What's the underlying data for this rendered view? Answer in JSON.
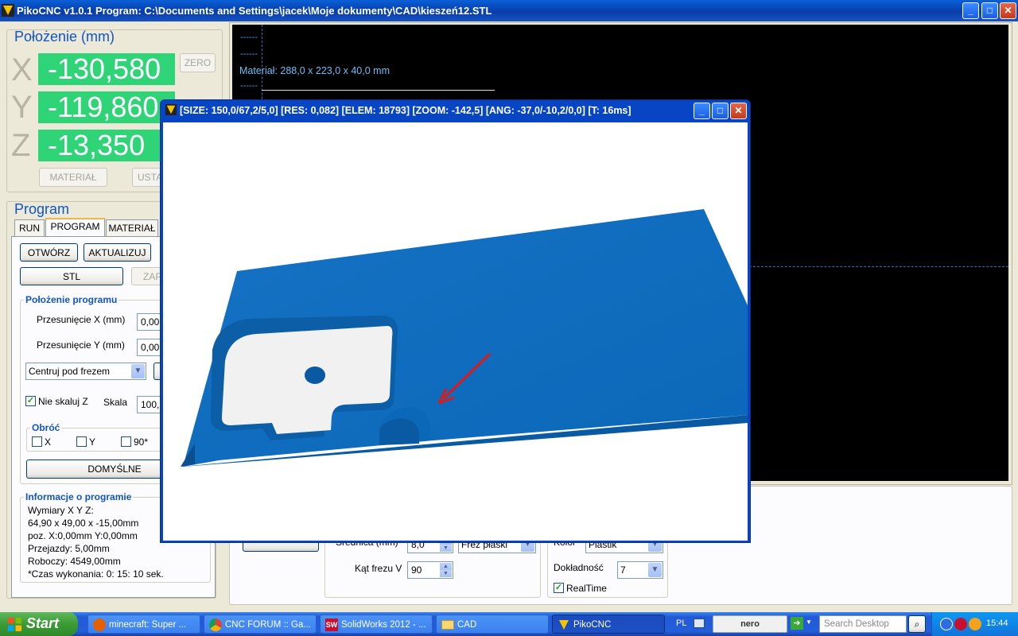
{
  "app": {
    "title": "PikoCNC v1.0.1    Program: C:\\Documents and Settings\\jacek\\Moje dokumenty\\CAD\\kieszeń12.STL"
  },
  "position": {
    "heading": "Położenie (mm)",
    "x_label": "X",
    "x_value": "-130,580",
    "y_label": "Y",
    "y_value": "-119,860",
    "z_label": "Z",
    "z_value": "-13,350",
    "zero_label": "ZERO",
    "material_label": "MATERIAŁ",
    "set_label": "USTA"
  },
  "program": {
    "heading": "Program",
    "tabs": [
      "RUN",
      "PROGRAM",
      "MATERIAŁ"
    ],
    "open_label": "OTWÓRZ",
    "update_label": "AKTUALIZUJ",
    "stl_label": "STL",
    "save_label": "ZAP",
    "placement": {
      "label": "Położenie programu",
      "offset_x_label": "Przesunięcie X (mm)",
      "offset_x_value": "0,00",
      "offset_y_label": "Przesunięcie Y (mm)",
      "offset_y_value": "0,00",
      "center_value": "Centruj pod frezem",
      "no_scale_z_label": "Nie skaluj Z",
      "scale_label": "Skala",
      "scale_value": "100,",
      "rotate_label": "Obróć",
      "rot_x": "X",
      "rot_y": "Y",
      "rot_90": "90*",
      "defaults_label": "DOMYŚLNE"
    },
    "info": {
      "label": "Informacje o programie",
      "lines": [
        "Wymiary X Y Z:",
        "64,90 x 49,00 x -15,00mm",
        "poz. X:0,00mm Y:0,00mm",
        "Przejazdy: 5,00mm",
        "Roboczy: 4549,00mm",
        "*Czas wykonania: 0: 15: 10 sek."
      ]
    }
  },
  "viewport": {
    "dash1": "------",
    "dash2": "------",
    "dash3": "------",
    "material_text": "Materiał: 288,0 x 223,0 x 40,0 mm"
  },
  "tool": {
    "diameter_label": "Średnica (mm)",
    "diameter_value": "8,0",
    "type_value": "Frez płaski",
    "angle_label": "Kąt frezu V",
    "angle_value": "90",
    "color_label": "Kolor",
    "color_value": "Plastik",
    "precision_label": "Dokładność",
    "precision_value": "7",
    "realtime_label": "RealTime"
  },
  "preview": {
    "title": "[SIZE: 150,0/67,2/5,0] [RES: 0,082] [ELEM: 18793] [ZOOM: -142,5] [ANG: -37,0/-10,2/0,0] [T: 16ms]"
  },
  "taskbar": {
    "start": "Start",
    "items": [
      "minecraft: Super ...",
      "CNC FORUM :: Ga...",
      "SolidWorks 2012 - ...",
      "CAD",
      "PikoCNC"
    ],
    "lang": "PL",
    "nero": "nero",
    "search_placeholder": "Search Desktop",
    "clock": "15:44"
  },
  "colors": {
    "accent": "#1154c7",
    "dro_bg": "#2fd477",
    "model": "#0a6fc2",
    "arrow": "#e01818"
  }
}
